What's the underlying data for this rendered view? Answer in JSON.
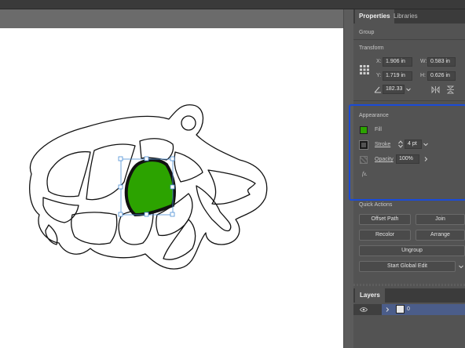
{
  "panel": {
    "tabs": [
      "Properties",
      "Libraries"
    ],
    "group_label": "Group",
    "transform": {
      "title": "Transform",
      "x_label": "X:",
      "x_value": "1.906 in",
      "y_label": "Y:",
      "y_value": "1.719 in",
      "w_label": "W:",
      "w_value": "0.583 in",
      "h_label": "H:",
      "h_value": "0.626 in",
      "angle_value": "182.33"
    },
    "appearance": {
      "title": "Appearance",
      "fill_label": "Fill",
      "stroke_label": "Stroke",
      "stroke_value": "4 pt",
      "opacity_label": "Opacity",
      "opacity_value": "100%",
      "fx_label": "fx."
    },
    "quick_actions": {
      "title": "Quick Actions",
      "offset_path": "Offset Path",
      "join": "Join",
      "recolor": "Recolor",
      "arrange": "Arrange",
      "ungroup": "Ungroup",
      "start_global_edit": "Start Global Edit"
    },
    "layers": {
      "tab_label": "Layers",
      "layer_name": "0"
    }
  },
  "colors": {
    "fill": "#2ca300",
    "highlight": "#1a4bd8",
    "selection": "#4b8fd6"
  }
}
